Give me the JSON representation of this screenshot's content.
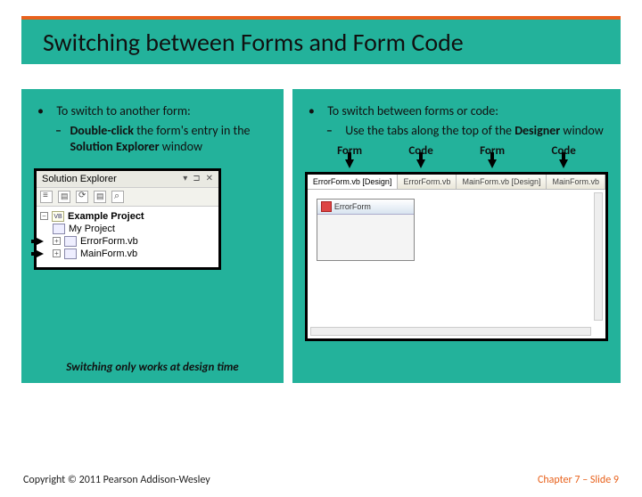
{
  "title": "Switching between Forms and Form Code",
  "left": {
    "b1": "To switch to another form:",
    "b2_pre": "Double-click",
    "b2_mid": " the form's entry in the ",
    "b2_bold": "Solution Explorer",
    "b2_post": " window",
    "solexp_title": "Solution Explorer",
    "project": "Example Project",
    "items": [
      "My Project",
      "ErrorForm.vb",
      "MainForm.vb"
    ]
  },
  "right": {
    "b1": "To switch between forms or code:",
    "b2_pre": "Use the tabs along the top of the ",
    "b2_bold": "Designer",
    "b2_post": " window",
    "tab_labels": [
      "Form",
      "Code",
      "Form",
      "Code"
    ],
    "tabs": [
      "ErrorForm.vb [Design]",
      "ErrorForm.vb",
      "MainForm.vb [Design]",
      "MainForm.vb"
    ],
    "mini_form_title": "ErrorForm"
  },
  "note": "Switching only works at design time",
  "footer": {
    "copyright": "Copyright © 2011 Pearson Addison-Wesley",
    "chapter": "Chapter 7 – Slide 9"
  }
}
